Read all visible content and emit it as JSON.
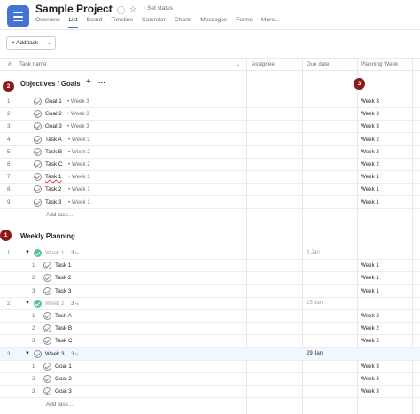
{
  "project": {
    "title": "Sample Project",
    "status_label": "Set status"
  },
  "tabs": [
    "Overview",
    "List",
    "Board",
    "Timeline",
    "Calendar",
    "Charts",
    "Messages",
    "Forms",
    "More..."
  ],
  "active_tab": "List",
  "toolbar": {
    "add_task": "+ Add task"
  },
  "columns": {
    "hash": "#",
    "task_name": "Task name",
    "assignee": "Assignee",
    "due_date": "Due date",
    "planning_week": "Planning Week"
  },
  "badges": {
    "b1": "1",
    "b2": "2",
    "b3": "3"
  },
  "section1": {
    "title": "Objectives / Goals",
    "add_icon": "+",
    "more_icon": "···",
    "rows": [
      {
        "num": "1",
        "name": "Goal 1",
        "tag": "• Week 3",
        "week": "Week 3"
      },
      {
        "num": "2",
        "name": "Goal 2",
        "tag": "• Week 3",
        "week": "Week 3"
      },
      {
        "num": "3",
        "name": "Goal 3",
        "tag": "• Week 3",
        "week": "Week 3"
      },
      {
        "num": "4",
        "name": "Task A",
        "tag": "• Week 2",
        "week": "Week 2"
      },
      {
        "num": "5",
        "name": "Task B",
        "tag": "• Week 2",
        "week": "Week 2"
      },
      {
        "num": "6",
        "name": "Task C",
        "tag": "• Week 2",
        "week": "Week 2"
      },
      {
        "num": "7",
        "name": "Task 1",
        "tag": "• Week 1",
        "week": "Week 1"
      },
      {
        "num": "8",
        "name": "Task 2",
        "tag": "• Week 1",
        "week": "Week 1"
      },
      {
        "num": "9",
        "name": "Task 3",
        "tag": "• Week 1",
        "week": "Week 1"
      }
    ],
    "add_task": "Add task..."
  },
  "section2": {
    "title": "Weekly Planning",
    "groups": [
      {
        "num": "1",
        "name": "Week 1",
        "subcount": "3 ⤷",
        "due": "8 Jan",
        "done": true,
        "tasks": [
          {
            "num": "1",
            "name": "Task 1",
            "week": "Week 1"
          },
          {
            "num": "2",
            "name": "Task 2",
            "week": "Week 1"
          },
          {
            "num": "3",
            "name": "Task 3",
            "week": "Week 1"
          }
        ]
      },
      {
        "num": "2",
        "name": "Week 2",
        "subcount": "3 ⤷",
        "due": "15 Jan",
        "done": true,
        "tasks": [
          {
            "num": "1",
            "name": "Task A",
            "week": "Week 2"
          },
          {
            "num": "2",
            "name": "Task B",
            "week": "Week 2"
          },
          {
            "num": "3",
            "name": "Task C",
            "week": "Week 2"
          }
        ]
      },
      {
        "num": "3",
        "name": "Week 3",
        "subcount": "3 ⤷",
        "due": "29 Jan",
        "done": false,
        "tasks": [
          {
            "num": "1",
            "name": "Goal 1",
            "week": "Week 3"
          },
          {
            "num": "2",
            "name": "Goal 2",
            "week": "Week 3"
          },
          {
            "num": "3",
            "name": "Goal 3",
            "week": "Week 3"
          }
        ]
      }
    ],
    "add_task": "Add task..."
  },
  "colors": {
    "accent": "#4573d2",
    "badge": "#8b1a1a",
    "done": "#58c494",
    "highlight": "#f1f7fe"
  },
  "icons": [
    "project-list-icon",
    "chevron-down-icon",
    "info-icon",
    "star-icon",
    "status-dot-icon",
    "caret-down-icon",
    "check-circle-icon",
    "subtask-icon",
    "more-icon",
    "plus-icon"
  ]
}
